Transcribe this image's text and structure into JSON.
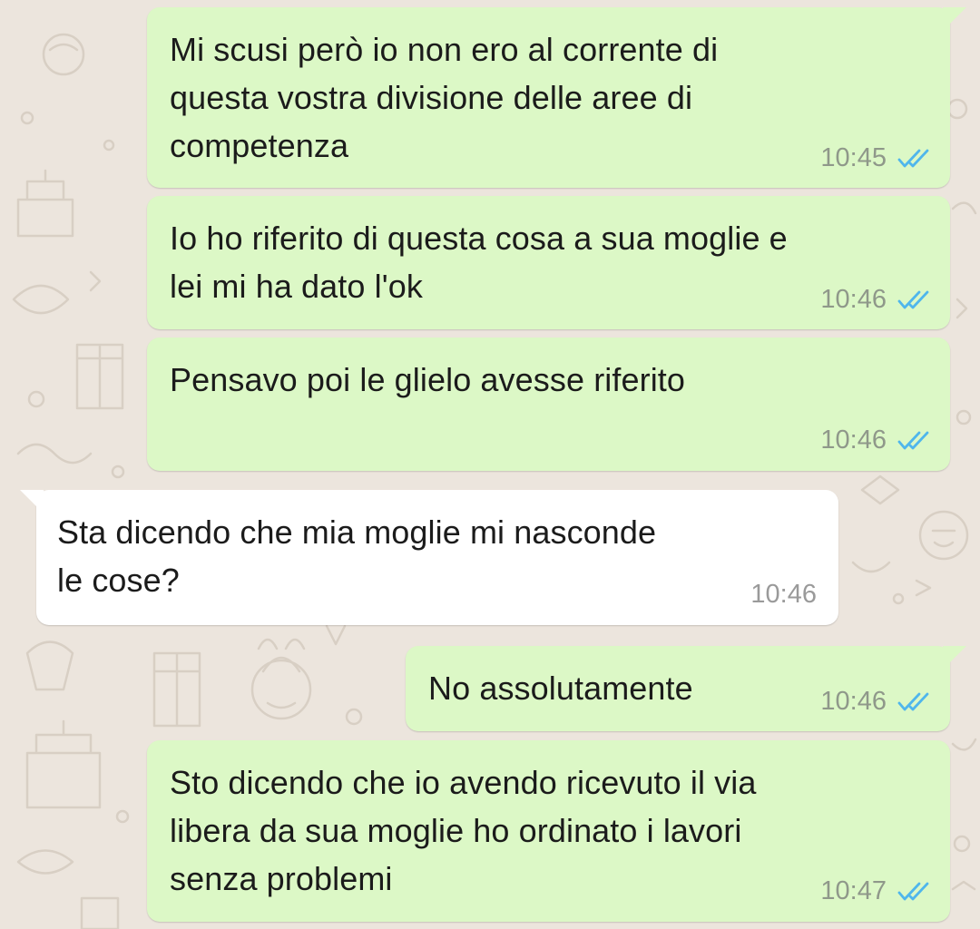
{
  "colors": {
    "outgoing_bubble": "#dcf8c6",
    "incoming_bubble": "#ffffff",
    "background": "#ece5dd",
    "read_ticks": "#4fb6ec"
  },
  "messages": [
    {
      "direction": "out",
      "lines": [
        "Mi scusi però io non ero al corrente di",
        "questa vostra divisione delle aree di",
        "competenza"
      ],
      "time": "10:45",
      "status": "double-tick-read-icon"
    },
    {
      "direction": "out",
      "lines": [
        "Io ho riferito di questa cosa a sua moglie e",
        "lei mi ha dato l'ok"
      ],
      "time": "10:46",
      "status": "double-tick-read-icon"
    },
    {
      "direction": "out",
      "lines": [
        "Pensavo poi le glielo avesse riferito"
      ],
      "time": "10:46",
      "status": "double-tick-read-icon"
    },
    {
      "direction": "in",
      "lines": [
        "Sta dicendo che mia moglie mi nasconde",
        "le cose?"
      ],
      "time": "10:46"
    },
    {
      "direction": "out",
      "lines": [
        "No assolutamente"
      ],
      "time": "10:46",
      "status": "double-tick-read-icon"
    },
    {
      "direction": "out",
      "lines": [
        "Sto dicendo che io avendo ricevuto il via",
        "libera da sua moglie ho ordinato i lavori",
        "senza problemi"
      ],
      "time": "10:47",
      "status": "double-tick-read-icon"
    }
  ]
}
